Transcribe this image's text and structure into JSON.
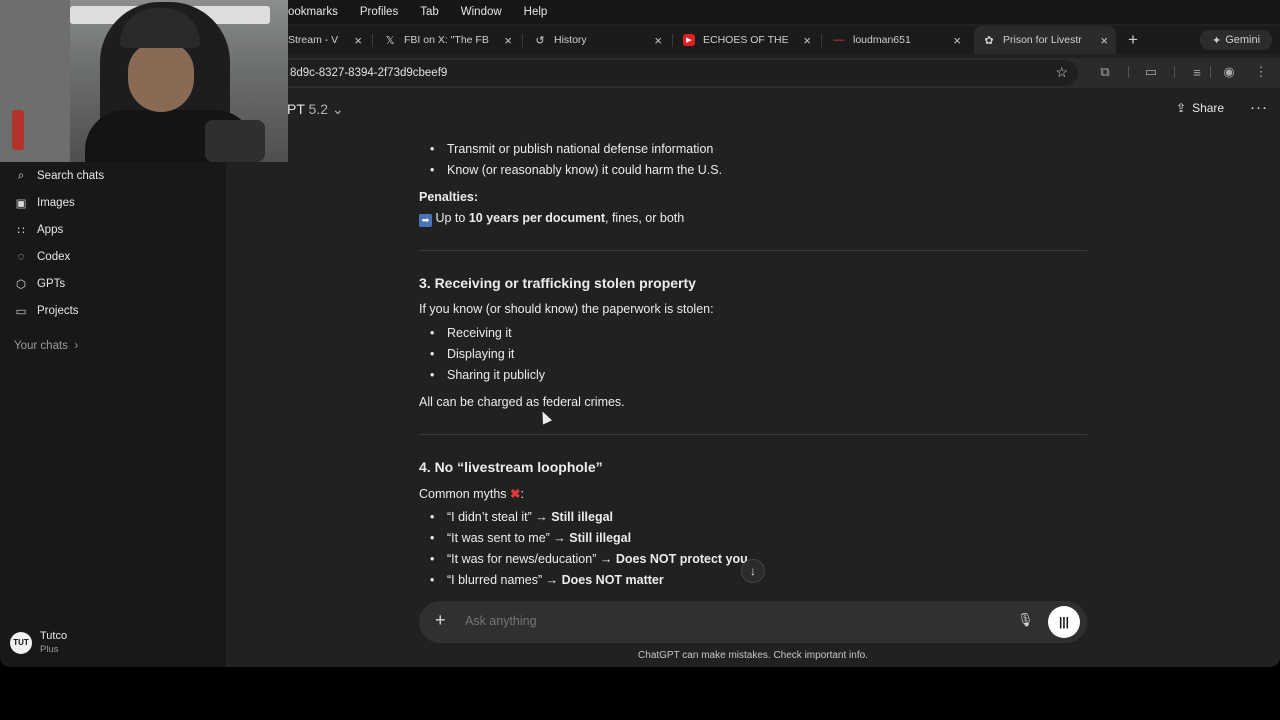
{
  "menubar": [
    "ookmarks",
    "Profiles",
    "Tab",
    "Window",
    "Help"
  ],
  "tabs": [
    {
      "label": "Stream - V",
      "icon": "document-icon"
    },
    {
      "label": "FBI on X: \"The FB",
      "icon": "x-logo-icon"
    },
    {
      "label": "History",
      "icon": "history-icon"
    },
    {
      "label": "ECHOES OF THE",
      "icon": "youtube-icon"
    },
    {
      "label": "loudman651",
      "icon": "kick-icon"
    },
    {
      "label": "Prison for Livestr",
      "icon": "chatgpt-icon"
    }
  ],
  "gemini_label": "Gemini",
  "address": "8d9c-8327-8394-2f73d9cbeef9",
  "sidebar": {
    "items": [
      {
        "label": "Search chats",
        "icon": "search-icon"
      },
      {
        "label": "Images",
        "icon": "image-icon"
      },
      {
        "label": "Apps",
        "icon": "apps-icon"
      },
      {
        "label": "Codex",
        "icon": "codex-icon"
      },
      {
        "label": "GPTs",
        "icon": "gpts-icon"
      },
      {
        "label": "Projects",
        "icon": "folder-icon"
      }
    ],
    "your_chats": "Your chats",
    "profile": {
      "name": "Tutco",
      "plan": "Plus"
    }
  },
  "header": {
    "model": "PT",
    "version": "5.2",
    "share": "Share"
  },
  "content": {
    "li_transmit": "Transmit or publish national defense information",
    "li_know": "Know (or reasonably know) it could harm the U.S.",
    "penalties_label": "Penalties:",
    "penalty_prefix": "Up to ",
    "penalty_bold": "10 years per document",
    "penalty_suffix": ", fines, or both",
    "section3_title": "3. Receiving or trafficking stolen property",
    "section3_intro": "If you know (or should know) the paperwork is stolen:",
    "section3_items": [
      "Receiving it",
      "Displaying it",
      "Sharing it publicly"
    ],
    "section3_outro": "All can be charged as federal crimes.",
    "section4_title": "4. No “livestream loophole”",
    "myths_label": "Common myths",
    "myths": [
      {
        "quote": "“I didn’t steal it” → ",
        "verdict": "Still illegal"
      },
      {
        "quote": "“It was sent to me” → ",
        "verdict": "Still illegal"
      },
      {
        "quote": "“It was for news/education” → ",
        "verdict": "Does NOT protect you"
      },
      {
        "quote": "“I blurred names” → ",
        "verdict": "Does NOT matter"
      }
    ]
  },
  "composer": {
    "placeholder": "Ask anything",
    "disclaimer": "ChatGPT can make mistakes. Check important info."
  }
}
